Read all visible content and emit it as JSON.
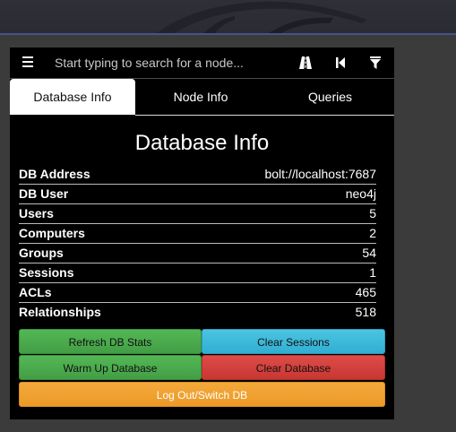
{
  "search": {
    "placeholder": "Start typing to search for a node...",
    "menu_icon": "hamburger-menu-icon",
    "pathfinding_icon": "road-pathfinding-icon",
    "back_icon": "step-backward-icon",
    "filter_icon": "filter-icon"
  },
  "tabs": [
    {
      "label": "Database Info",
      "active": true
    },
    {
      "label": "Node Info",
      "active": false
    },
    {
      "label": "Queries",
      "active": false
    }
  ],
  "database_info": {
    "title": "Database Info",
    "rows": [
      {
        "key": "DB Address",
        "value": "bolt://localhost:7687"
      },
      {
        "key": "DB User",
        "value": "neo4j"
      },
      {
        "key": "Users",
        "value": "5"
      },
      {
        "key": "Computers",
        "value": "2"
      },
      {
        "key": "Groups",
        "value": "54"
      },
      {
        "key": "Sessions",
        "value": "1"
      },
      {
        "key": "ACLs",
        "value": "465"
      },
      {
        "key": "Relationships",
        "value": "518"
      }
    ]
  },
  "buttons": {
    "refresh_db_stats": "Refresh DB Stats",
    "clear_sessions": "Clear Sessions",
    "warm_up_database": "Warm Up Database",
    "clear_database": "Clear Database",
    "log_out_switch_db": "Log Out/Switch DB"
  },
  "colors": {
    "panel_bg": "#000000",
    "page_bg": "#3b3b3b",
    "accent_line": "#46528c",
    "green_button": "#48a84a",
    "blue_button": "#3cb8da",
    "red_button": "#d2403c",
    "orange_button": "#f0a231"
  }
}
